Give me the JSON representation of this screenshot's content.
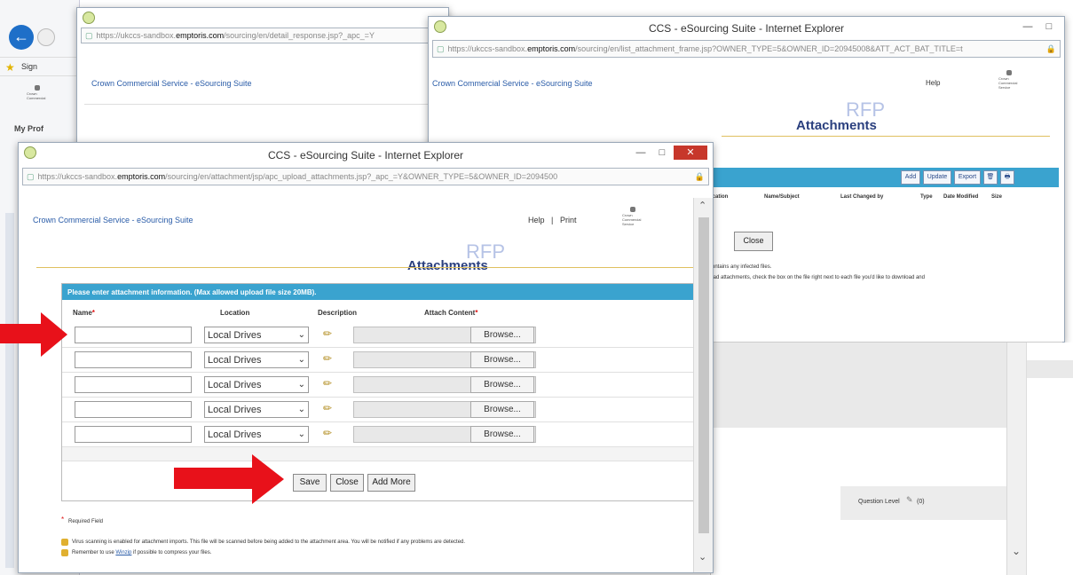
{
  "colors": {
    "accent": "#3aa3cf",
    "arrow": "#e8111a",
    "title": "#2a3f7e",
    "brand_link": "#2a5ca8",
    "close_button": "#c7372b"
  },
  "background_browser": {
    "back_icon": "back-arrow-icon",
    "favorites_label": "Sign",
    "my_pro_label": "My Prof"
  },
  "window_left_back": {
    "url_prefix": "https://",
    "url_sub": "ukccs-sandbox.",
    "url_domain": "emptoris.com",
    "url_path": "/sourcing/en/detail_response.jsp?_apc_=Y",
    "header": "Crown Commercial Service - eSourcing Suite"
  },
  "window_right": {
    "title": "CCS - eSourcing Suite - Internet Explorer",
    "url_prefix": "https://",
    "url_sub": "ukccs-sandbox.",
    "url_domain": "emptoris.com",
    "url_path": "/sourcing/en/list_attachment_frame.jsp?OWNER_TYPE=5&OWNER_ID=20945008&ATT_ACT_BAT_TITLE=t",
    "header": "Crown Commercial Service - eSourcing Suite",
    "help": "Help",
    "rfp": "RFP",
    "attachments": "Attachments",
    "toolbar": [
      "Add",
      "Update",
      "Export"
    ],
    "columns": [
      "ncation",
      "Name/Subject",
      "Last Changed by",
      "Type",
      "Date Modified",
      "Size"
    ],
    "close_button": "Close",
    "info_line1": "contains any infected files.",
    "info_line2": "load attachments, check the box on the file right next to each file you'd like to download and",
    "question_level": "Question Level",
    "question_count": "(0)"
  },
  "window_front": {
    "title": "CCS - eSourcing Suite - Internet Explorer",
    "url_prefix": "https://",
    "url_sub": "ukccs-sandbox.",
    "url_domain": "emptoris.com",
    "url_path": "/sourcing/en/attachment/jsp/apc_upload_attachments.jsp?_apc_=Y&OWNER_TYPE=5&OWNER_ID=2094500",
    "header": "Crown Commercial Service - eSourcing Suite",
    "help": "Help",
    "separator": "|",
    "print": "Print",
    "logo_text": "Crown Commercial Service",
    "rfp": "RFP",
    "attachments": "Attachments",
    "bar_text": "Please enter attachment information. (Max allowed upload file size 20MB).",
    "col_name": "Name",
    "col_location": "Location",
    "col_description": "Description",
    "col_attach": "Attach Content",
    "required_star": "*",
    "rows": [
      {
        "location": "Local Drives",
        "browse": "Browse..."
      },
      {
        "location": "Local Drives",
        "browse": "Browse..."
      },
      {
        "location": "Local Drives",
        "browse": "Browse..."
      },
      {
        "location": "Local Drives",
        "browse": "Browse..."
      },
      {
        "location": "Local Drives",
        "browse": "Browse..."
      }
    ],
    "save": "Save",
    "close": "Close",
    "add_more": "Add More",
    "required_field": "Required Field",
    "note1": "Virus scanning is enabled for attachment imports. This file will be scanned before being added to the attachment area. You will be notified if any problems are detected.",
    "note2_prefix": "Remember to use",
    "note2_link": "Winzip",
    "note2_suffix": "if possible to compress your files."
  }
}
